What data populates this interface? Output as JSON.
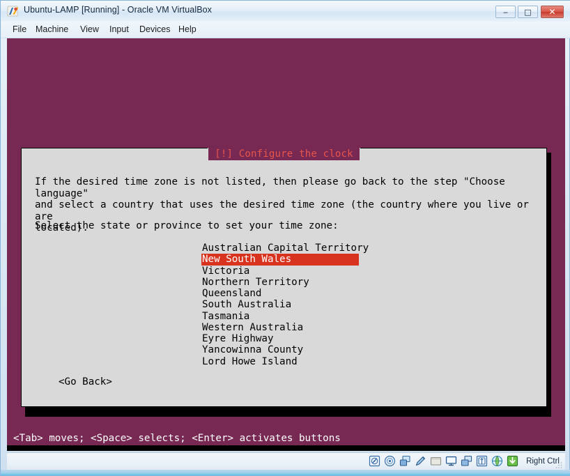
{
  "window": {
    "title": "Ubuntu-LAMP [Running] - Oracle VM VirtualBox",
    "app_icon": "virtualbox-icon",
    "buttons": {
      "minimize": "‒",
      "maximize": "□",
      "close": "✕"
    }
  },
  "menubar": {
    "items": [
      {
        "label": "File"
      },
      {
        "label": "Machine"
      },
      {
        "label": "View"
      },
      {
        "label": "Input"
      },
      {
        "label": "Devices"
      },
      {
        "label": "Help"
      }
    ]
  },
  "guest": {
    "background_color": "#772953",
    "dialog": {
      "title": "[!] Configure the clock",
      "title_color": "#e8554a",
      "background_color": "#d9d9d9",
      "body_text": "If the desired time zone is not listed, then please go back to the step \"Choose language\"\nand select a country that uses the desired time zone (the country where you live or are\nlocated).",
      "prompt": "Select the state or province to set your time zone:",
      "list": {
        "selected_index": 1,
        "highlight_color": "#d8331f",
        "highlight_text_color": "#ffffff",
        "items": [
          "Australian Capital Territory",
          "New South Wales",
          "Victoria",
          "Northern Territory",
          "Queensland",
          "South Australia",
          "Tasmania",
          "Western Australia",
          "Eyre Highway",
          "Yancowinna County",
          "Lord Howe Island"
        ]
      },
      "go_back_button": "<Go Back>"
    },
    "hint": "<Tab> moves; <Space> selects; <Enter> activates buttons"
  },
  "statusbar": {
    "host_key_label": "Right Ctrl",
    "icons": [
      {
        "name": "hard-disk-icon"
      },
      {
        "name": "optical-disk-icon"
      },
      {
        "name": "floppy-disk-icon"
      },
      {
        "name": "audio-icon"
      },
      {
        "name": "shared-folder-icon"
      },
      {
        "name": "display-icon"
      },
      {
        "name": "network-adapter-icon"
      },
      {
        "name": "usb-icon"
      },
      {
        "name": "remote-desktop-icon"
      },
      {
        "name": "capture-icon"
      }
    ]
  }
}
